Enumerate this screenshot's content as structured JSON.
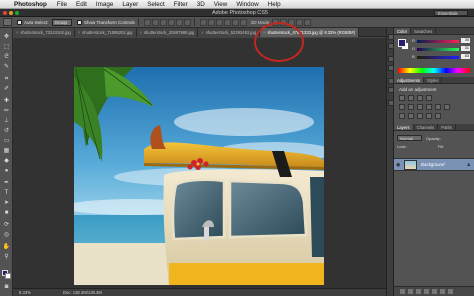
{
  "menubar": {
    "apple": "",
    "app_name": "Photoshop",
    "items": [
      "File",
      "Edit",
      "Image",
      "Layer",
      "Select",
      "Filter",
      "3D",
      "View",
      "Window",
      "Help"
    ]
  },
  "window": {
    "title": "Adobe Photoshop CS5",
    "workspace": "Essentials"
  },
  "options": {
    "auto_select_label": "Auto-Select:",
    "auto_select_value": "Group",
    "transform_label": "Show Transform Controls",
    "mode_3d": "3D Mode:"
  },
  "tabs": [
    {
      "label": "shutterstock_73243162.jpg",
      "active": false
    },
    {
      "label": "shutterstock_71895202.jpg",
      "active": false
    },
    {
      "label": "shutterstock_20697988.jpg",
      "active": false
    },
    {
      "label": "shutterstock_52392493.jpg",
      "active": false
    },
    {
      "label": "shutterstock_47671333.jpg @ 8.33% (RGB/8#)",
      "active": true
    }
  ],
  "status": {
    "zoom": "8.33%",
    "doc_size": "Doc: 138.3M/138.3M"
  },
  "panels": {
    "color_tabs": [
      "Color",
      "Swatches"
    ],
    "color": {
      "channels": [
        {
          "label": "R",
          "value": "35"
        },
        {
          "label": "G",
          "value": "31"
        },
        {
          "label": "B",
          "value": "83"
        }
      ],
      "foreground": "#2a1f6e",
      "background": "#ffffff"
    },
    "adjustments_tabs": [
      "Adjustments",
      "Styles"
    ],
    "adjustments_title": "Add an adjustment",
    "layers_tabs": [
      "Layers",
      "Channels",
      "Paths"
    ],
    "blend_mode": "Normal",
    "opacity_label": "Opacity:",
    "lock_label": "Lock:",
    "fill_label": "Fill:",
    "layer_name": "Background"
  },
  "colors": {
    "accent_ring": "#c0281f",
    "selected_layer": "#7a93b5"
  }
}
